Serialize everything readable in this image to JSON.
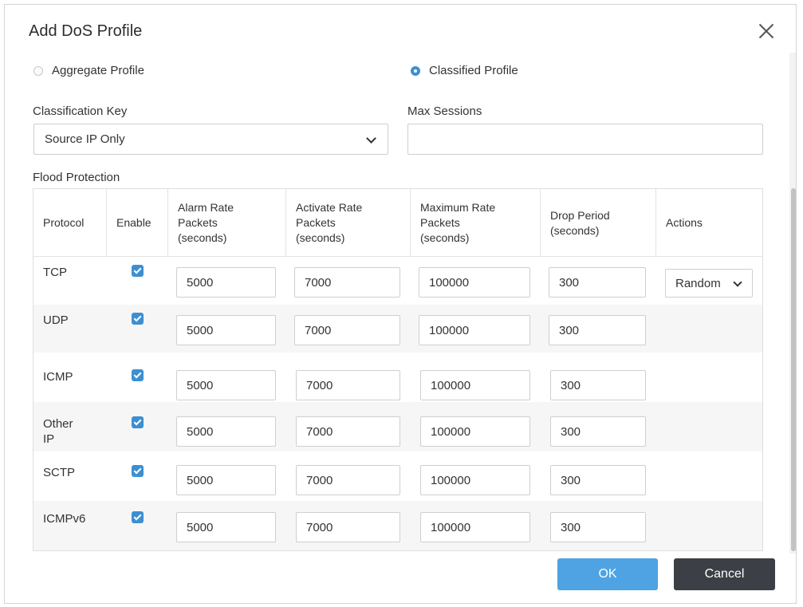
{
  "dialog": {
    "title": "Add DoS Profile"
  },
  "profile_type": {
    "options": [
      {
        "label": "Aggregate Profile",
        "selected": false
      },
      {
        "label": "Classified Profile",
        "selected": true
      }
    ]
  },
  "classification_key": {
    "label": "Classification Key",
    "value": "Source IP Only"
  },
  "max_sessions": {
    "label": "Max Sessions",
    "value": ""
  },
  "flood_protection": {
    "label": "Flood Protection",
    "columns": {
      "protocol": "Protocol",
      "enable": "Enable",
      "alarm": [
        "Alarm Rate",
        "Packets",
        "(seconds)"
      ],
      "activate": [
        "Activate Rate",
        "Packets",
        "(seconds)"
      ],
      "maximum": [
        "Maximum Rate",
        "Packets",
        "(seconds)"
      ],
      "drop": [
        "Drop Period",
        "(seconds)"
      ],
      "actions": "Actions"
    },
    "rows": [
      {
        "protocol": [
          "TCP"
        ],
        "enabled": true,
        "alarm": "5000",
        "activate": "7000",
        "maximum": "100000",
        "drop": "300",
        "action": "Random"
      },
      {
        "protocol": [
          "UDP"
        ],
        "enabled": true,
        "alarm": "5000",
        "activate": "7000",
        "maximum": "100000",
        "drop": "300"
      },
      {
        "protocol": [
          "ICMP"
        ],
        "enabled": true,
        "alarm": "5000",
        "activate": "7000",
        "maximum": "100000",
        "drop": "300"
      },
      {
        "protocol": [
          "Other",
          "IP"
        ],
        "enabled": true,
        "alarm": "5000",
        "activate": "7000",
        "maximum": "100000",
        "drop": "300"
      },
      {
        "protocol": [
          "SCTP"
        ],
        "enabled": true,
        "alarm": "5000",
        "activate": "7000",
        "maximum": "100000",
        "drop": "300"
      },
      {
        "protocol": [
          "ICMPv6"
        ],
        "enabled": true,
        "alarm": "5000",
        "activate": "7000",
        "maximum": "100000",
        "drop": "300"
      }
    ]
  },
  "buttons": {
    "ok": "OK",
    "cancel": "Cancel"
  },
  "colors": {
    "accent": "#3d8fd1",
    "ok_button": "#4fa3e3",
    "cancel_button": "#3c3f45"
  },
  "icons": {
    "close": "close-icon",
    "dropdown": "chevron-down-icon",
    "checkbox": "checkmark-icon"
  }
}
